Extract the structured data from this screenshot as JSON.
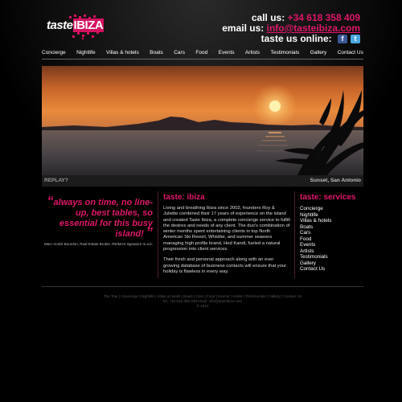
{
  "header": {
    "logo_part1": "taste",
    "logo_part2": "IBIZA",
    "call_label": "call us:",
    "call_value": "+34 618 358 409",
    "email_label": "email us:",
    "email_value": "info@tasteibiza.com",
    "online_label": "taste us online:",
    "social": {
      "facebook_glyph": "f",
      "twitter_glyph": "t"
    }
  },
  "nav": {
    "items": [
      "Concierge",
      "Nightlife",
      "Villas & hotels",
      "Boats",
      "Cars",
      "Food",
      "Events",
      "Artists",
      "Testimonials",
      "Gallery",
      "Contact Us"
    ]
  },
  "hero": {
    "replay_label": "REPLAY?",
    "caption": "Sunset, San Antonio"
  },
  "quote": {
    "open_mark": "“",
    "text": "always on time, no line-up, best tables,  so essential for this busy island!",
    "close_mark": "”",
    "attribution": "Marc-André Bourdon, Real Estate Broker, RE/MAX signature m.a.b."
  },
  "about": {
    "heading": "taste: ibiza",
    "paragraph1": "Living and breathing Ibiza since 2002, founders Roy & Juliette combined their 17 years of experience on the island and created Taste Ibiza, a complete concierge service to fulfill the desires and needs of any client. The duo's combination of winter months spent entertaining clients in top North American Ski Resort, Whistler, and summer seasons managing high profile brand, Hed Kandi, fueled a natural progression into client services.",
    "paragraph2": "Their fresh and personal approach along with an ever growing database of business contacts will ensure that your holiday is flawless in every way."
  },
  "services": {
    "heading": "taste: services",
    "items": [
      "Concierge",
      "Nightlife",
      "Villas & hotels",
      "Boats",
      "Cars",
      "Food",
      "Events",
      "Artists",
      "Testimonials",
      "Gallery",
      "Contact Us"
    ]
  },
  "footer": {
    "links": "The Tour | Concierge | Nightlife | Villas & hotels | Boats | Cars | Food | Events | Artists | Testimonials | Gallery | Contact Us",
    "contact": "tel. +34 618 358 409  email. info@tasteibiza.com",
    "copyright": "© 2010"
  },
  "colors": {
    "accent": "#e0176a",
    "background": "#000000"
  }
}
